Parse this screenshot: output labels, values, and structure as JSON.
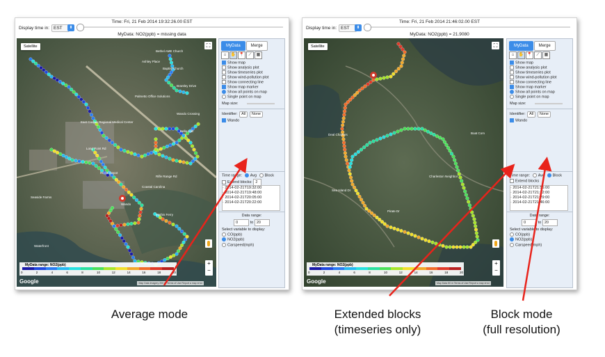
{
  "left": {
    "time_label": "Time: Fri, 21 Feb 2014 19:32:26.00 EST",
    "display_time_label": "Display time in:",
    "timezone": "EST",
    "mydata_status": "MyData: NO2(ppb) = missing data",
    "map": {
      "type_button": "Satellite",
      "labels": [
        "Bethel AME Church",
        "Ashley Place",
        "Baptist Church",
        "Brantley Drive",
        "Wando Crossing",
        "Palmetto Office Solutions",
        "East Cooper Regional Medical Center",
        "Belle Hall",
        "Long Point Rd",
        "Coastal Carolina",
        "Home Depot",
        "Rifle Range Rd",
        "Wando",
        "Seaside Farms",
        "Waterfront",
        "Mathis Ferry"
      ],
      "legend_title": "MyData range: NO2(ppb)",
      "legend_ticks": [
        "0",
        "2",
        "4",
        "6",
        "8",
        "10",
        "12",
        "14",
        "16",
        "18",
        "20"
      ],
      "google": "Google",
      "attribution": "Map Data  Imagery  200 m  Terms of Use  Report a map error"
    },
    "panel": {
      "tabs": [
        "MyData",
        "Merge"
      ],
      "options": [
        {
          "label": "Show map",
          "on": true,
          "kind": "cb"
        },
        {
          "label": "Show analysis plot",
          "on": false,
          "kind": "cb"
        },
        {
          "label": "Show timeseries plot",
          "on": false,
          "kind": "cb"
        },
        {
          "label": "Show wind-pollution plot",
          "on": false,
          "kind": "cb"
        },
        {
          "label": "Show connecting line",
          "on": false,
          "kind": "cb"
        },
        {
          "label": "Show map marker",
          "on": true,
          "kind": "cb"
        },
        {
          "label": "Show all points on map",
          "on": true,
          "kind": "rb"
        },
        {
          "label": "Single point on map",
          "on": false,
          "kind": "rb"
        }
      ],
      "map_size": "Map size:",
      "identifier": "Identifier:",
      "all": "All",
      "none": "None",
      "identifier_item": "Wando",
      "time_range": "Time range:",
      "avg": "Avg",
      "block": "Block",
      "extend_blocks": "Extend blocks:",
      "extend_value": "2",
      "time_list": [
        "2014-02-21T19:32:00",
        "2014-02-21T19:48:00",
        "2014-02-21T20:05:00",
        "2014-02-21T20:22:00"
      ],
      "data_range": "Data range:",
      "range_min": "0",
      "range_to": "to",
      "range_max": "20",
      "select_var": "Select variable to display:",
      "variables": [
        {
          "label": "CO(ppb)",
          "on": false
        },
        {
          "label": "NO2(ppb)",
          "on": true
        },
        {
          "label": "Carspeed(mph)",
          "on": false
        }
      ]
    }
  },
  "right": {
    "time_label": "Time: Fri, 21 Feb 2014 21:46:02.00 EST",
    "display_time_label": "Display time in:",
    "timezone": "EST",
    "mydata_status": "MyData: NO2(ppb) = 21.9080",
    "map": {
      "type_button": "Satellite",
      "labels": [
        "Deal Charters",
        "Boat Com",
        "Charleston Neighbor",
        "Pirate Dr",
        "Sea Island Dr"
      ],
      "legend_title": "MyData range: NO2(ppb)",
      "legend_ticks": [
        "0",
        "2",
        "4",
        "6",
        "8",
        "10",
        "12",
        "14",
        "16",
        "18",
        "20"
      ],
      "google": "Google",
      "attribution": "Map Data  50 m  Terms of Use  Report a map error"
    },
    "panel": {
      "tabs": [
        "MyData",
        "Merge"
      ],
      "options": [
        {
          "label": "Show map",
          "on": true,
          "kind": "cb"
        },
        {
          "label": "Show analysis plot",
          "on": false,
          "kind": "cb"
        },
        {
          "label": "Show timeseries plot",
          "on": false,
          "kind": "cb"
        },
        {
          "label": "Show wind-pollution plot",
          "on": false,
          "kind": "cb"
        },
        {
          "label": "Show connecting line",
          "on": false,
          "kind": "cb"
        },
        {
          "label": "Show map marker",
          "on": true,
          "kind": "cb"
        },
        {
          "label": "Show all points on map",
          "on": true,
          "kind": "rb"
        },
        {
          "label": "Single point on map",
          "on": false,
          "kind": "rb"
        }
      ],
      "map_size": "Map size:",
      "identifier": "Identifier:",
      "all": "All",
      "none": "None",
      "identifier_item": "Wando",
      "time_range": "Time range:",
      "avg": "Avg",
      "block": "Block",
      "extend_blocks": "Extend blocks",
      "extend_value": "",
      "time_list": [
        "2014-02-21T21:55:00",
        "2014-02-21T21:12:00",
        "2014-02-21T21:29:00",
        "2014-02-21T21:46:00"
      ],
      "data_range": "Data range:",
      "range_min": "0",
      "range_to": "to",
      "range_max": "20",
      "select_var": "Select variable to display:",
      "variables": [
        {
          "label": "CO(ppb)",
          "on": false
        },
        {
          "label": "NO2(ppb)",
          "on": true
        },
        {
          "label": "Carspeed(mph)",
          "on": false
        }
      ]
    }
  },
  "captions": {
    "average_mode": "Average mode",
    "extended_blocks_1": "Extended blocks",
    "extended_blocks_2": "(timeseries only)",
    "block_mode_1": "Block mode",
    "block_mode_2": "(full resolution)"
  },
  "colors": {
    "accent": "#3b8ce8",
    "arrow": "#e8231b",
    "legend_scale": [
      "#1a1aa8",
      "#1f49e0",
      "#2a7df2",
      "#27b9f2",
      "#27e0e0",
      "#2ae0a0",
      "#4be05a",
      "#a8e62a",
      "#f2e02a",
      "#f2a92a",
      "#f26d2a",
      "#e03a2a",
      "#b82020"
    ]
  }
}
